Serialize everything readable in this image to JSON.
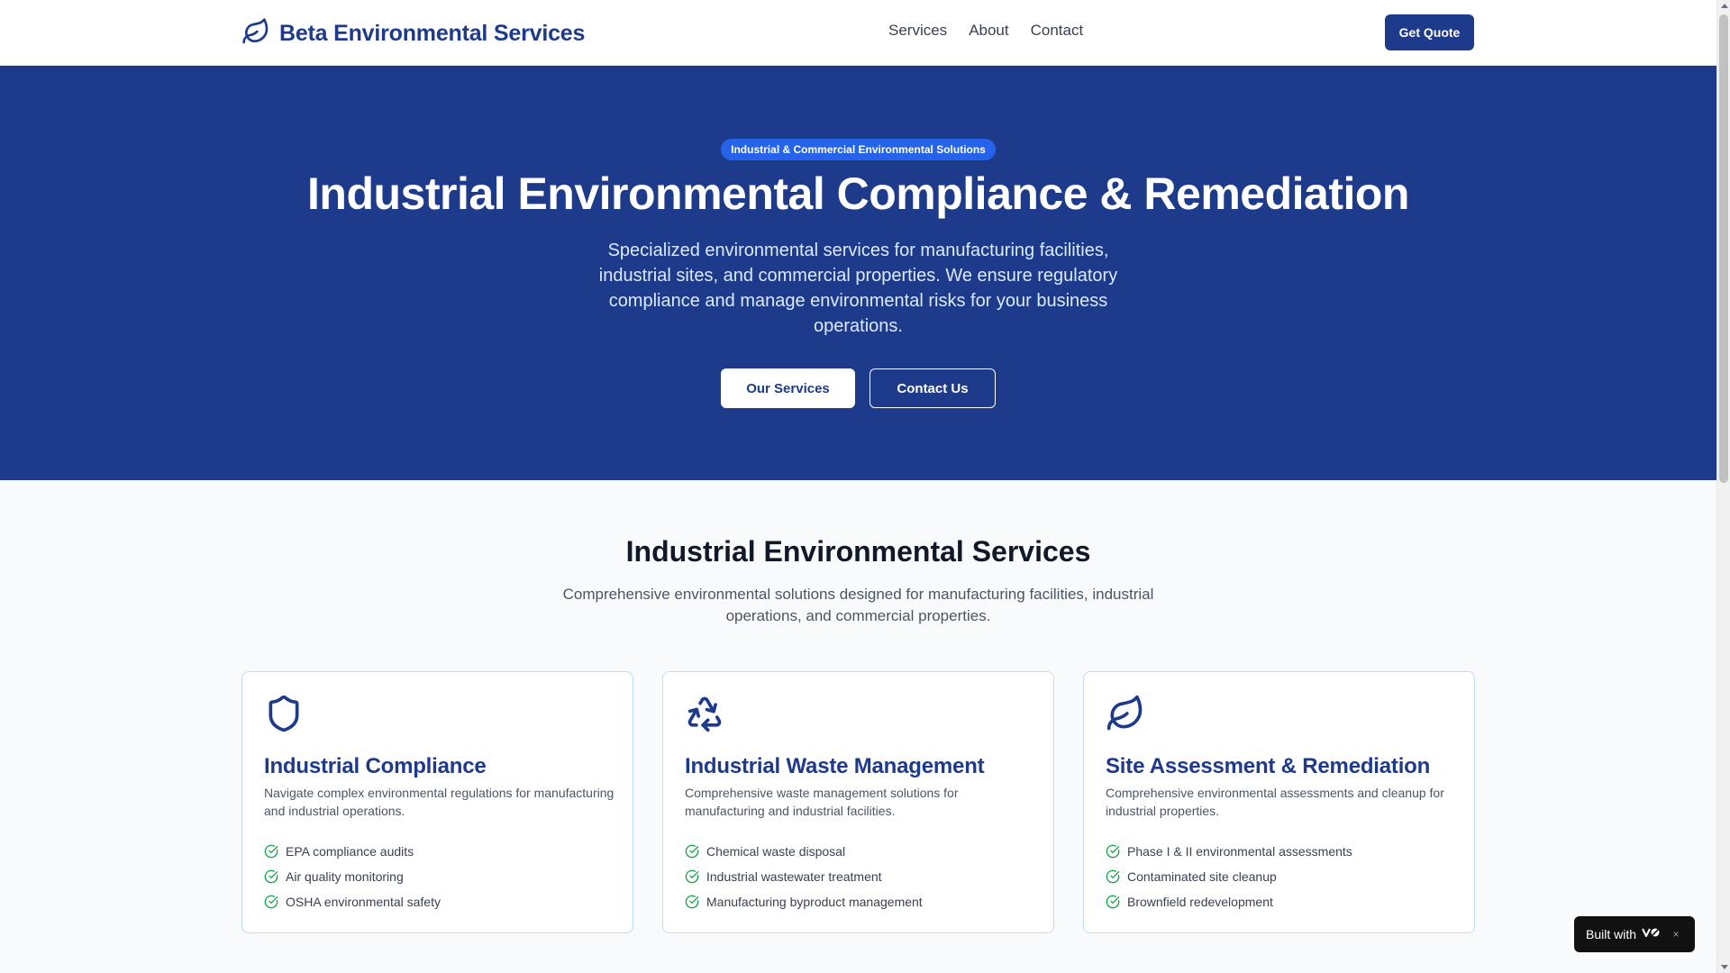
{
  "colors": {
    "brand_navy": "#1e3a8a",
    "badge_blue": "#2563eb",
    "check_green": "#16a34a",
    "card_border": "#bfdbfe"
  },
  "header": {
    "logo_icon": "leaf-icon",
    "brand": "Beta Environmental Services",
    "nav": [
      "Services",
      "About",
      "Contact"
    ],
    "cta": "Get Quote"
  },
  "hero": {
    "badge": "Industrial & Commercial Environmental Solutions",
    "title": "Industrial Environmental Compliance & Remediation",
    "subtitle": "Specialized environmental services for manufacturing facilities, industrial sites, and commercial properties. We ensure regulatory compliance and manage environmental risks for your business operations.",
    "primary_button": "Our Services",
    "secondary_button": "Contact Us"
  },
  "services": {
    "title": "Industrial Environmental Services",
    "subtitle": "Comprehensive environmental solutions designed for manufacturing facilities, industrial operations, and commercial properties.",
    "cards": [
      {
        "icon": "shield-icon",
        "title": "Industrial Compliance",
        "description": "Navigate complex environmental regulations for manufacturing and industrial operations.",
        "items": [
          "EPA compliance audits",
          "Air quality monitoring",
          "OSHA environmental safety"
        ]
      },
      {
        "icon": "recycle-icon",
        "title": "Industrial Waste Management",
        "description": "Comprehensive waste management solutions for manufacturing and industrial facilities.",
        "items": [
          "Chemical waste disposal",
          "Industrial wastewater treatment",
          "Manufacturing byproduct management"
        ]
      },
      {
        "icon": "leaf-icon",
        "title": "Site Assessment & Remediation",
        "description": "Comprehensive environmental assessments and cleanup for industrial properties.",
        "items": [
          "Phase I & II environmental assessments",
          "Contaminated site cleanup",
          "Brownfield redevelopment"
        ]
      }
    ]
  },
  "badge": {
    "label": "Built with",
    "close": "×"
  }
}
